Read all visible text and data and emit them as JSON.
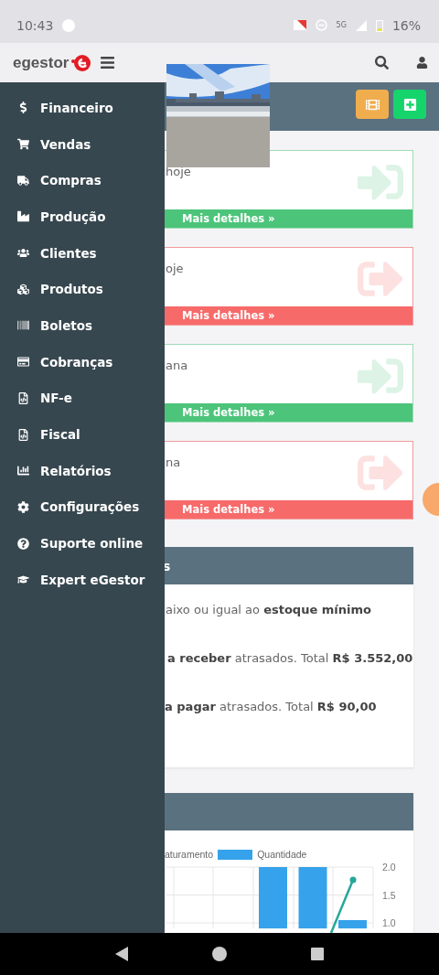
{
  "status_bar": {
    "time": "10:43",
    "network": "5G",
    "battery": "16%"
  },
  "app_header": {
    "logo": "egestor"
  },
  "sidebar": {
    "items": [
      {
        "label": "Financeiro"
      },
      {
        "label": "Vendas"
      },
      {
        "label": "Compras"
      },
      {
        "label": "Produção"
      },
      {
        "label": "Clientes"
      },
      {
        "label": "Produtos"
      },
      {
        "label": "Boletos"
      },
      {
        "label": "Cobranças"
      },
      {
        "label": "NF-e"
      },
      {
        "label": "Fiscal"
      },
      {
        "label": "Relatórios"
      },
      {
        "label": "Configurações"
      },
      {
        "label": "Suporte online"
      },
      {
        "label": "Expert eGestor"
      }
    ]
  },
  "toolbar": {
    "buttons": [
      {
        "kind": "video"
      },
      {
        "kind": "add"
      }
    ]
  },
  "cards": [
    {
      "kind": "in",
      "text": "hoje",
      "link": "Mais detalhes »"
    },
    {
      "kind": "out",
      "text": "oje",
      "link": "Mais detalhes »"
    },
    {
      "kind": "in",
      "text": "ana",
      "link": "Mais detalhes »"
    },
    {
      "kind": "out",
      "text": "na",
      "link": "Mais detalhes »"
    }
  ],
  "alerts_panel": {
    "title": "s",
    "lines": [
      "aixo ou igual ao **estoque mínimo**",
      "**a receber** atrasados. Total **R$ 3.552,00**",
      "**a pagar** atrasados. Total **R$ 90,00**"
    ]
  },
  "chart_panel": {
    "line_legend": {
      "label": "aturamento",
      "color": "#26a69a"
    },
    "chart_data": {
      "type": "bar",
      "ylim": [
        0.9,
        2.0
      ],
      "yticks": [
        {
          "value": 1.0,
          "label": "1.0"
        },
        {
          "value": 1.5,
          "label": "1.5"
        },
        {
          "value": 2.0,
          "label": "2.0"
        }
      ],
      "series": [
        {
          "name": "Quantidade",
          "color": "#36a2eb",
          "values": [
            null,
            null,
            2.0,
            2.0,
            1.05
          ]
        }
      ]
    }
  }
}
